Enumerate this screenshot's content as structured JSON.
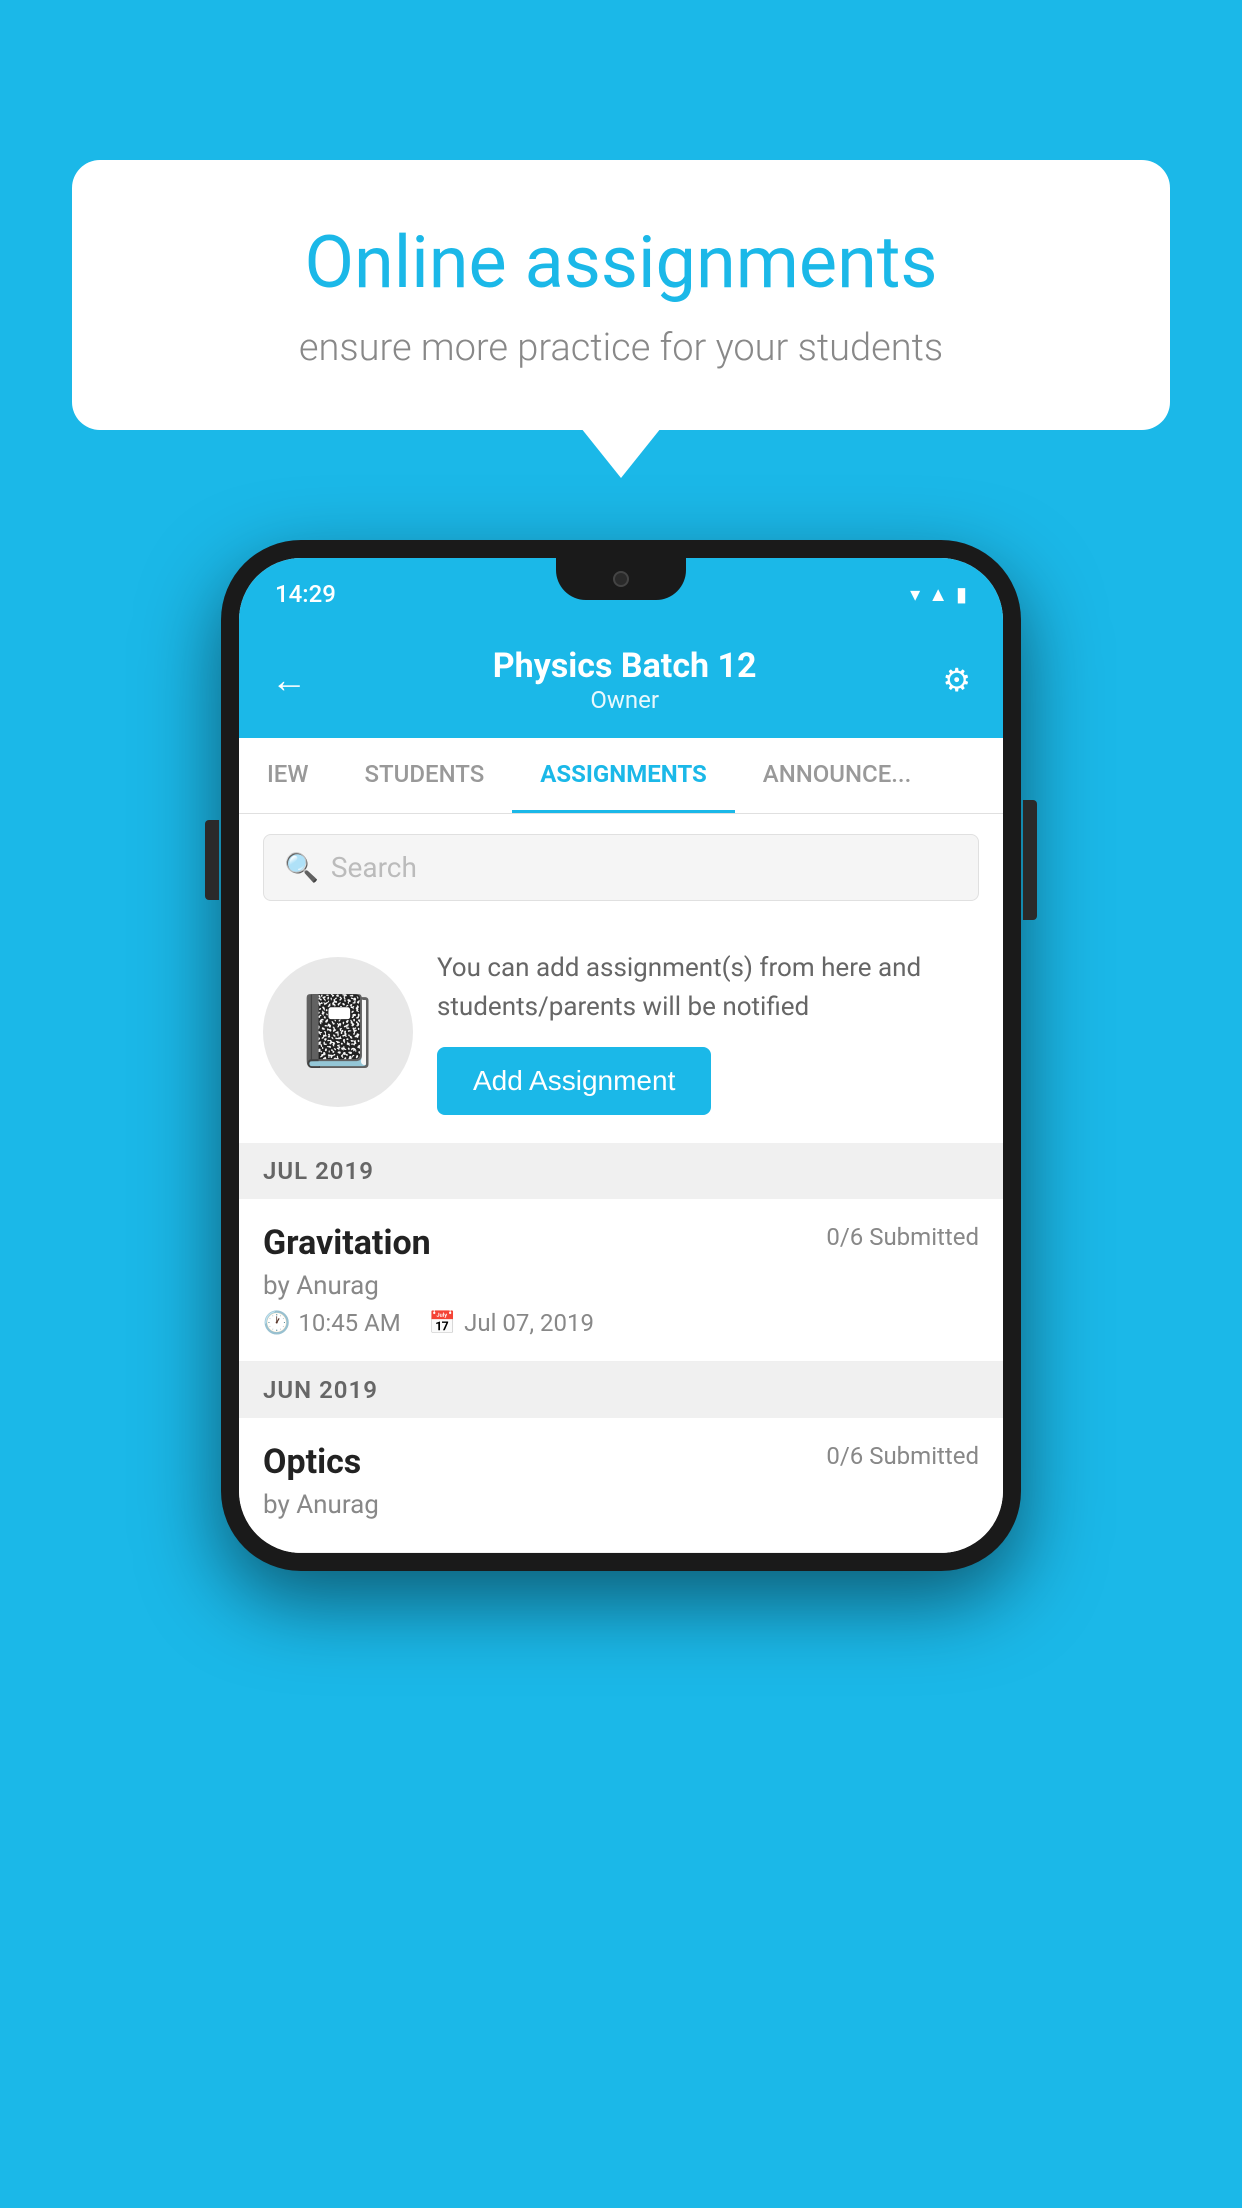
{
  "background_color": "#1BB8E8",
  "bubble": {
    "title": "Online assignments",
    "subtitle": "ensure more practice for your students"
  },
  "phone": {
    "status_bar": {
      "time": "14:29",
      "icons": [
        "wifi",
        "signal",
        "battery"
      ]
    },
    "header": {
      "title": "Physics Batch 12",
      "subtitle": "Owner"
    },
    "tabs": [
      {
        "label": "IEW",
        "active": false
      },
      {
        "label": "STUDENTS",
        "active": false
      },
      {
        "label": "ASSIGNMENTS",
        "active": true
      },
      {
        "label": "ANNOUNCEMENTS",
        "active": false
      }
    ],
    "search": {
      "placeholder": "Search"
    },
    "info_section": {
      "description": "You can add assignment(s) from here and students/parents will be notified",
      "button_label": "Add Assignment"
    },
    "sections": [
      {
        "month_label": "JUL 2019",
        "assignments": [
          {
            "name": "Gravitation",
            "submitted": "0/6 Submitted",
            "by": "by Anurag",
            "time": "10:45 AM",
            "date": "Jul 07, 2019"
          }
        ]
      },
      {
        "month_label": "JUN 2019",
        "assignments": [
          {
            "name": "Optics",
            "submitted": "0/6 Submitted",
            "by": "by Anurag",
            "time": "",
            "date": ""
          }
        ]
      }
    ]
  }
}
